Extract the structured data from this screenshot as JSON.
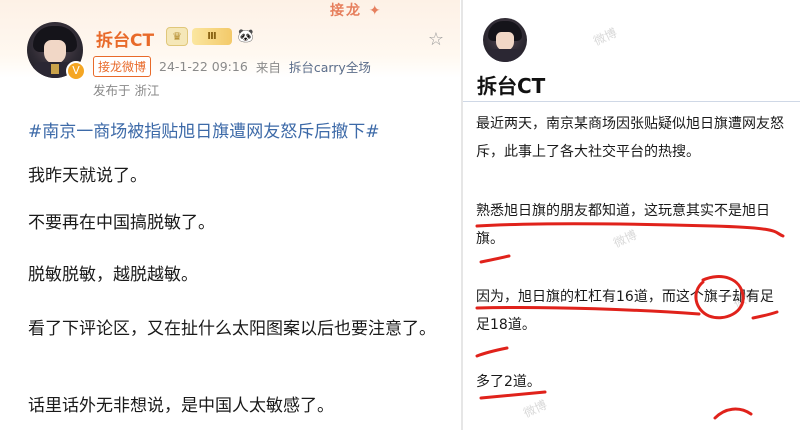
{
  "left_post": {
    "username": "拆台CT",
    "badges": {
      "level": "Ⅲ",
      "crown": "♛",
      "panda": "🐼"
    },
    "tag": "接龙微博",
    "timestamp": "24-1-22 09:16",
    "source_prefix": "来自",
    "source": "拆台carry全场",
    "posted_location": "发布于 浙江",
    "hashtag": "#南京一商场被指贴旭日旗遭网友怒斥后撤下#",
    "paragraphs": [
      "我昨天就说了。",
      "不要再在中国搞脱敏了。",
      "脱敏脱敏，越脱越敏。",
      "看了下评论区，又在扯什么太阳图案以后也要注意了。",
      "话里话外无非想说，是中国人太敏感了。"
    ],
    "banner_text": "接龙 ✦"
  },
  "right_post": {
    "username": "拆台CT",
    "paragraphs": [
      "最近两天，南京某商场因张贴疑似旭日旗遭网友怒斥，此事上了各大社交平台的热搜。",
      "熟悉旭日旗的朋友都知道，这玩意其实不是旭日旗。",
      "因为，旭日旗的杠杠有16道，而这个旗子却有足足18道。",
      "多了2道。"
    ],
    "watermark": "微博"
  },
  "colors": {
    "accent_orange": "#e86a2a",
    "link_blue": "#3d6aa8",
    "annotation_red": "#e0221b"
  }
}
